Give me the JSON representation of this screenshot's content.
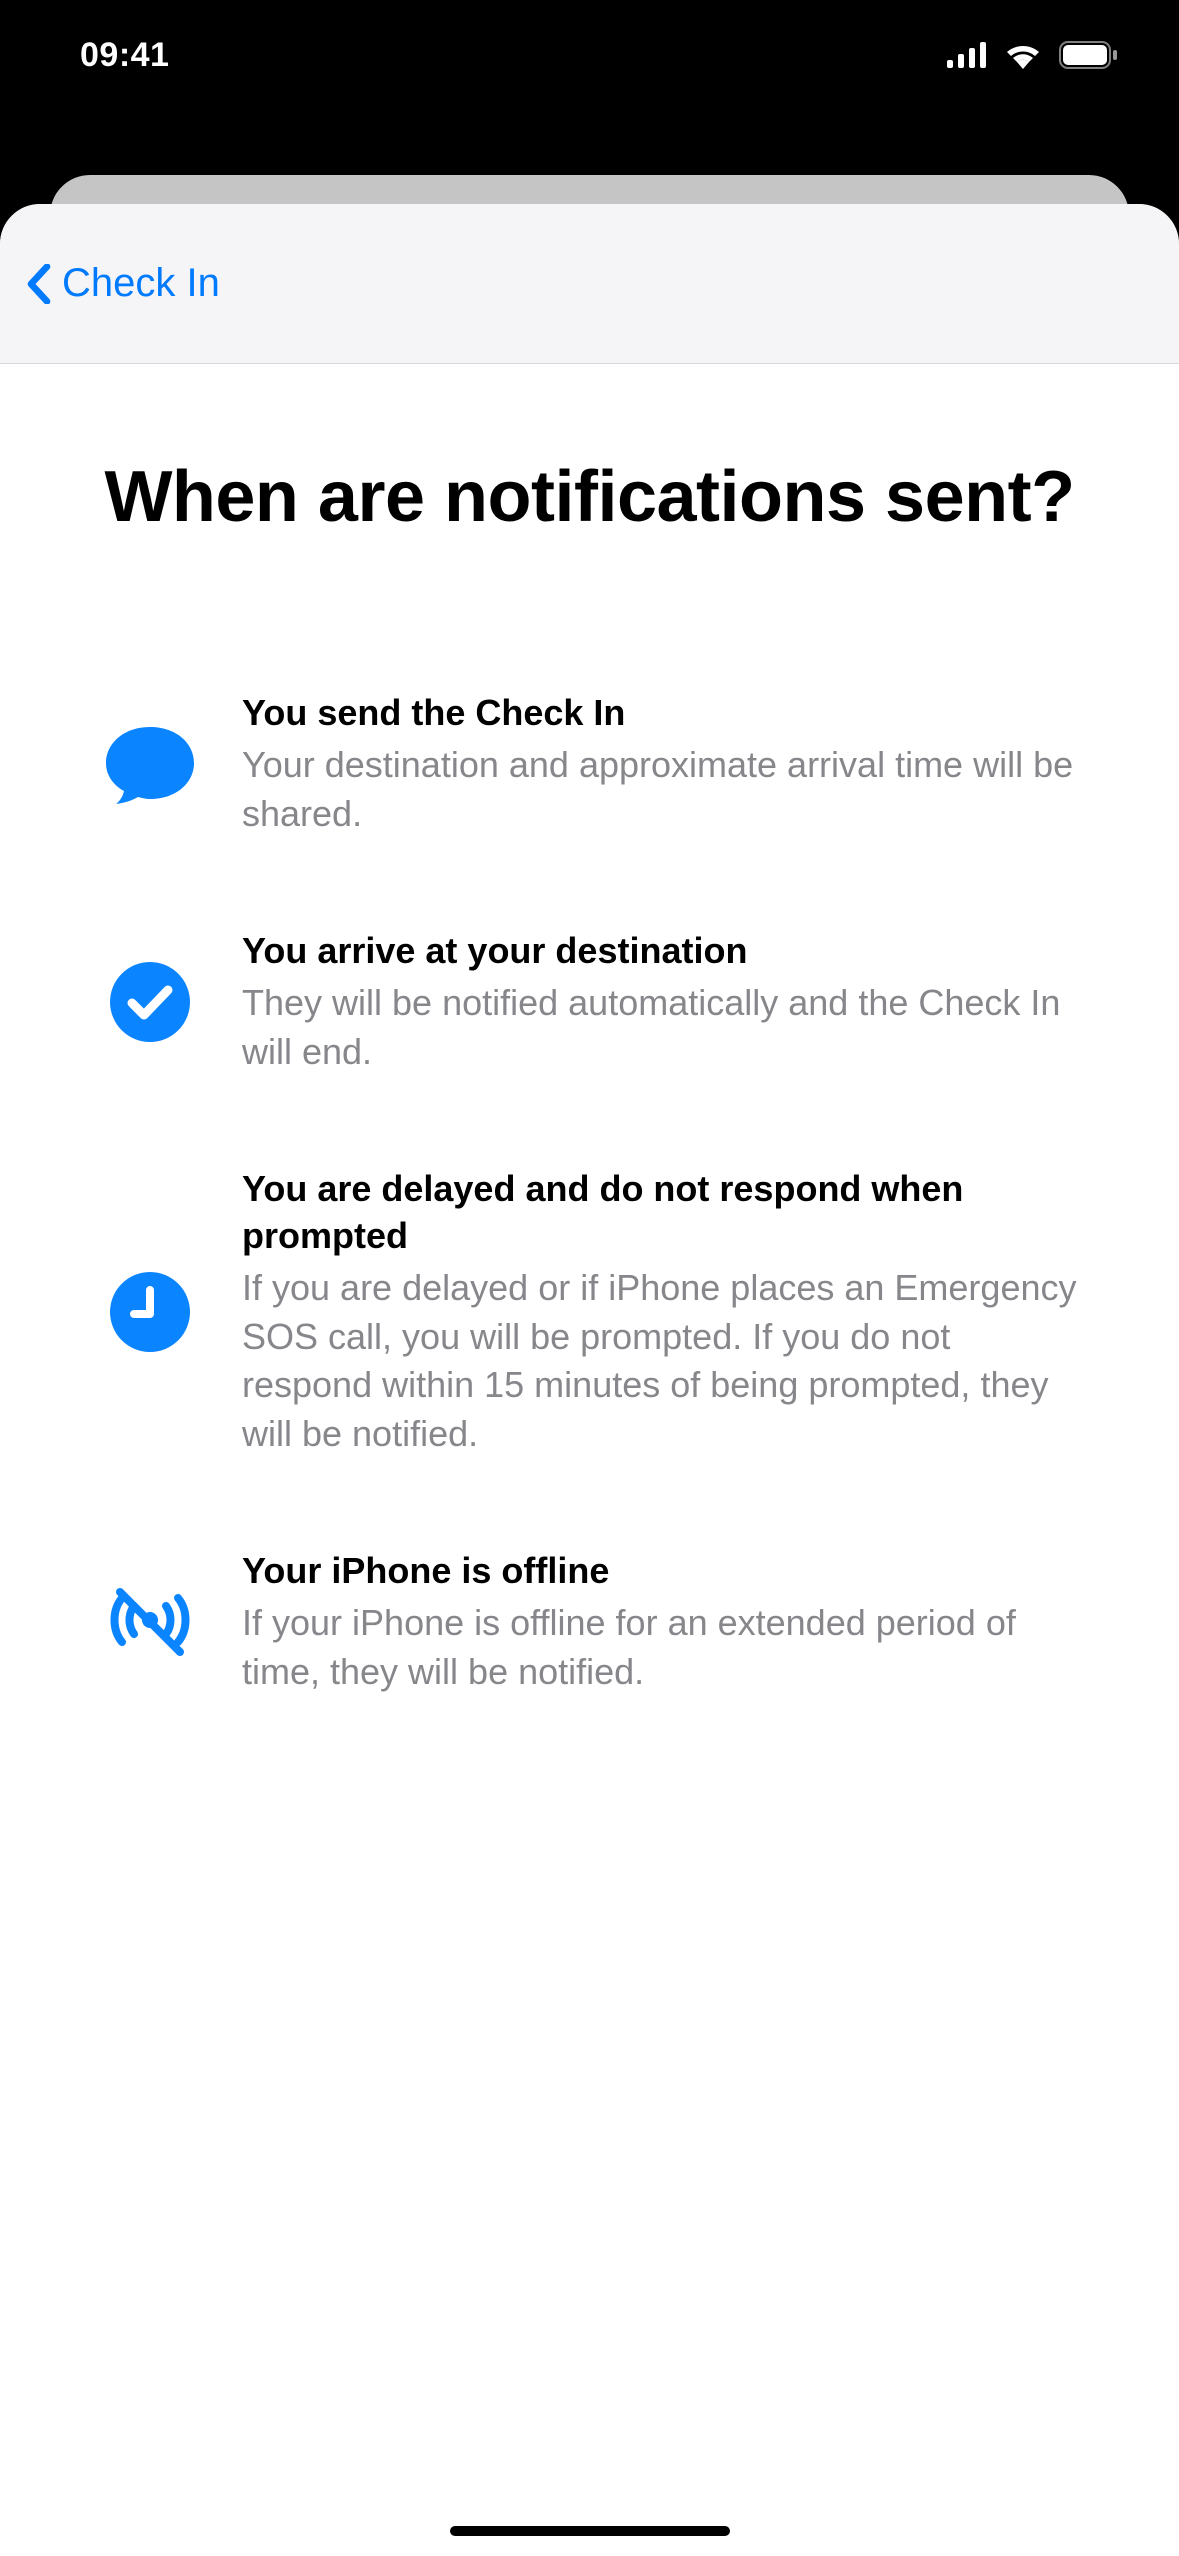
{
  "statusBar": {
    "time": "09:41"
  },
  "nav": {
    "backLabel": "Check In"
  },
  "page": {
    "title": "When are notifications sent?"
  },
  "items": [
    {
      "title": "You send the Check In",
      "body": "Your destination and approximate arrival time will be shared."
    },
    {
      "title": "You arrive at your destination",
      "body": "They will be notified automatically and the Check In will end."
    },
    {
      "title": "You are delayed and do not respond when prompted",
      "body": "If you are delayed or if iPhone places an Emergency SOS call, you will be prompted. If you do not respond within 15 minutes of being prompted, they will be notified."
    },
    {
      "title": "Your iPhone is offline",
      "body": "If your iPhone is offline for an extended period of time, they will be notified."
    }
  ]
}
